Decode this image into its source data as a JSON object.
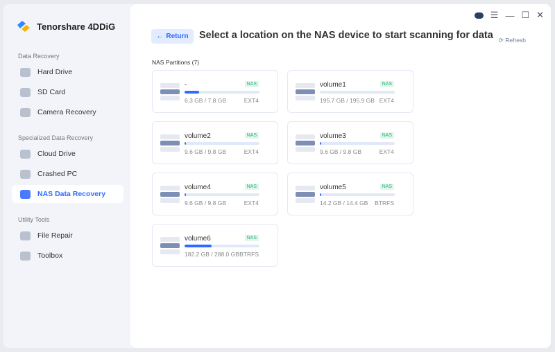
{
  "app": {
    "name": "Tenorshare 4DDiG"
  },
  "sidebar": {
    "sections": [
      {
        "title": "Data Recovery",
        "items": [
          {
            "label": "Hard Drive",
            "icon": "hard-drive-icon"
          },
          {
            "label": "SD Card",
            "icon": "sd-card-icon"
          },
          {
            "label": "Camera Recovery",
            "icon": "camera-icon"
          }
        ]
      },
      {
        "title": "Specialized Data Recovery",
        "items": [
          {
            "label": "Cloud Drive",
            "icon": "cloud-icon"
          },
          {
            "label": "Crashed PC",
            "icon": "crashed-pc-icon"
          },
          {
            "label": "NAS Data Recovery",
            "icon": "nas-icon",
            "active": true
          }
        ]
      },
      {
        "title": "Utility Tools",
        "items": [
          {
            "label": "File Repair",
            "icon": "file-repair-icon"
          },
          {
            "label": "Toolbox",
            "icon": "toolbox-icon"
          }
        ]
      }
    ]
  },
  "header": {
    "return_label": "Return",
    "title": "Select a location on the NAS device to start scanning for data",
    "refresh_label": "Refresh"
  },
  "partitions": {
    "label": "NAS Partitions (7)",
    "items": [
      {
        "name": "-",
        "badge": "NAS",
        "size": "6.3 GB / 7.8 GB",
        "fs": "EXT4",
        "fill": 0.19
      },
      {
        "name": "volume1",
        "badge": "NAS",
        "size": "195.7 GB / 195.9 GB",
        "fs": "EXT4",
        "fill": 0.0
      },
      {
        "name": "volume2",
        "badge": "NAS",
        "size": "9.6 GB / 9.8 GB",
        "fs": "EXT4",
        "fill": 0.02
      },
      {
        "name": "volume3",
        "badge": "NAS",
        "size": "9.6 GB / 9.8 GB",
        "fs": "EXT4",
        "fill": 0.02
      },
      {
        "name": "volume4",
        "badge": "NAS",
        "size": "9.6 GB / 9.8 GB",
        "fs": "EXT4",
        "fill": 0.02
      },
      {
        "name": "volume5",
        "badge": "NAS",
        "size": "14.2 GB / 14.4 GB",
        "fs": "BTRFS",
        "fill": 0.02
      },
      {
        "name": "volume6",
        "badge": "NAS",
        "size": "182.2 GB / 288.0 GB",
        "fs": "BTRFS",
        "fill": 0.36
      }
    ]
  }
}
